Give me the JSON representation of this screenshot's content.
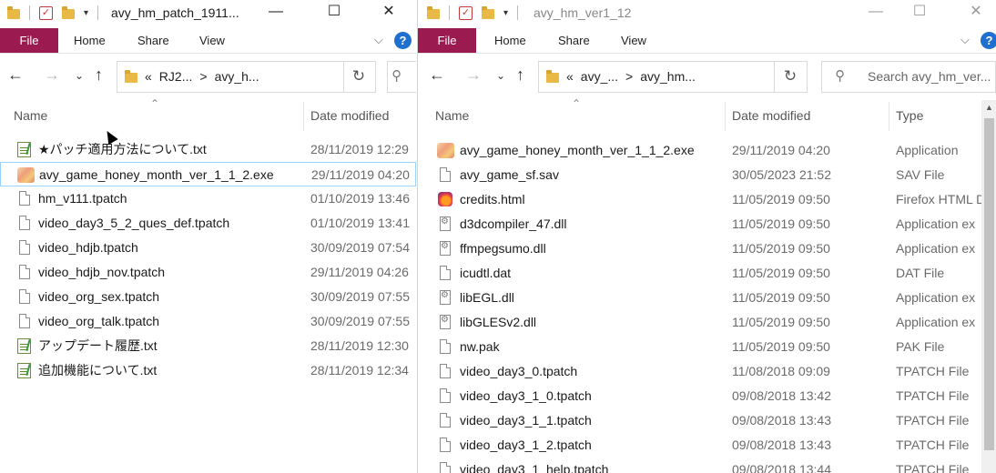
{
  "left_window": {
    "title": "avy_hm_patch_1911...",
    "ribbon": {
      "file": "File",
      "home": "Home",
      "share": "Share",
      "view": "View"
    },
    "breadcrumb": [
      "«",
      "RJ2...",
      ">",
      "avy_h..."
    ],
    "columns": {
      "name": "Name",
      "date": "Date modified"
    },
    "files": [
      {
        "name": "★パッチ適用方法について.txt",
        "date": "28/11/2019 12:29",
        "icon": "notepad-icon"
      },
      {
        "name": "avy_game_honey_month_ver_1_1_2.exe",
        "date": "29/11/2019 04:20",
        "icon": "app-icon"
      },
      {
        "name": "hm_v111.tpatch",
        "date": "01/10/2019 13:46",
        "icon": "file-icon"
      },
      {
        "name": "video_day3_5_2_ques_def.tpatch",
        "date": "01/10/2019 13:41",
        "icon": "file-icon"
      },
      {
        "name": "video_hdjb.tpatch",
        "date": "30/09/2019 07:54",
        "icon": "file-icon"
      },
      {
        "name": "video_hdjb_nov.tpatch",
        "date": "29/11/2019 04:26",
        "icon": "file-icon"
      },
      {
        "name": "video_org_sex.tpatch",
        "date": "30/09/2019 07:55",
        "icon": "file-icon"
      },
      {
        "name": "video_org_talk.tpatch",
        "date": "30/09/2019 07:55",
        "icon": "file-icon"
      },
      {
        "name": "アップデート履歴.txt",
        "date": "28/11/2019 12:30",
        "icon": "notepad-icon"
      },
      {
        "name": "追加機能について.txt",
        "date": "28/11/2019 12:34",
        "icon": "notepad-icon"
      }
    ]
  },
  "right_window": {
    "title": "avy_hm_ver1_12",
    "ribbon": {
      "file": "File",
      "home": "Home",
      "share": "Share",
      "view": "View"
    },
    "breadcrumb": [
      "«",
      "avy_...",
      ">",
      "avy_hm..."
    ],
    "search_placeholder": "Search avy_hm_ver...",
    "columns": {
      "name": "Name",
      "date": "Date modified",
      "type": "Type"
    },
    "files": [
      {
        "name": "avy_game_honey_month_ver_1_1_2.exe",
        "date": "29/11/2019 04:20",
        "type": "Application",
        "icon": "app-icon"
      },
      {
        "name": "avy_game_sf.sav",
        "date": "30/05/2023 21:52",
        "type": "SAV File",
        "icon": "file-icon"
      },
      {
        "name": "credits.html",
        "date": "11/05/2019 09:50",
        "type": "Firefox HTML D",
        "icon": "firefox-icon"
      },
      {
        "name": "d3dcompiler_47.dll",
        "date": "11/05/2019 09:50",
        "type": "Application ex",
        "icon": "dll-icon"
      },
      {
        "name": "ffmpegsumo.dll",
        "date": "11/05/2019 09:50",
        "type": "Application ex",
        "icon": "dll-icon"
      },
      {
        "name": "icudtl.dat",
        "date": "11/05/2019 09:50",
        "type": "DAT File",
        "icon": "file-icon"
      },
      {
        "name": "libEGL.dll",
        "date": "11/05/2019 09:50",
        "type": "Application ex",
        "icon": "dll-icon"
      },
      {
        "name": "libGLESv2.dll",
        "date": "11/05/2019 09:50",
        "type": "Application ex",
        "icon": "dll-icon"
      },
      {
        "name": "nw.pak",
        "date": "11/05/2019 09:50",
        "type": "PAK File",
        "icon": "file-icon"
      },
      {
        "name": "video_day3_0.tpatch",
        "date": "11/08/2018 09:09",
        "type": "TPATCH File",
        "icon": "file-icon"
      },
      {
        "name": "video_day3_1_0.tpatch",
        "date": "09/08/2018 13:42",
        "type": "TPATCH File",
        "icon": "file-icon"
      },
      {
        "name": "video_day3_1_1.tpatch",
        "date": "09/08/2018 13:43",
        "type": "TPATCH File",
        "icon": "file-icon"
      },
      {
        "name": "video_day3_1_2.tpatch",
        "date": "09/08/2018 13:43",
        "type": "TPATCH File",
        "icon": "file-icon"
      },
      {
        "name": "video_day3_1_help.tpatch",
        "date": "09/08/2018 13:44",
        "type": "TPATCH File",
        "icon": "file-icon"
      }
    ]
  },
  "colors": {
    "file_tab": "#9b1a4f",
    "help": "#1f6fd0",
    "selection_border": "#99d1ff"
  }
}
